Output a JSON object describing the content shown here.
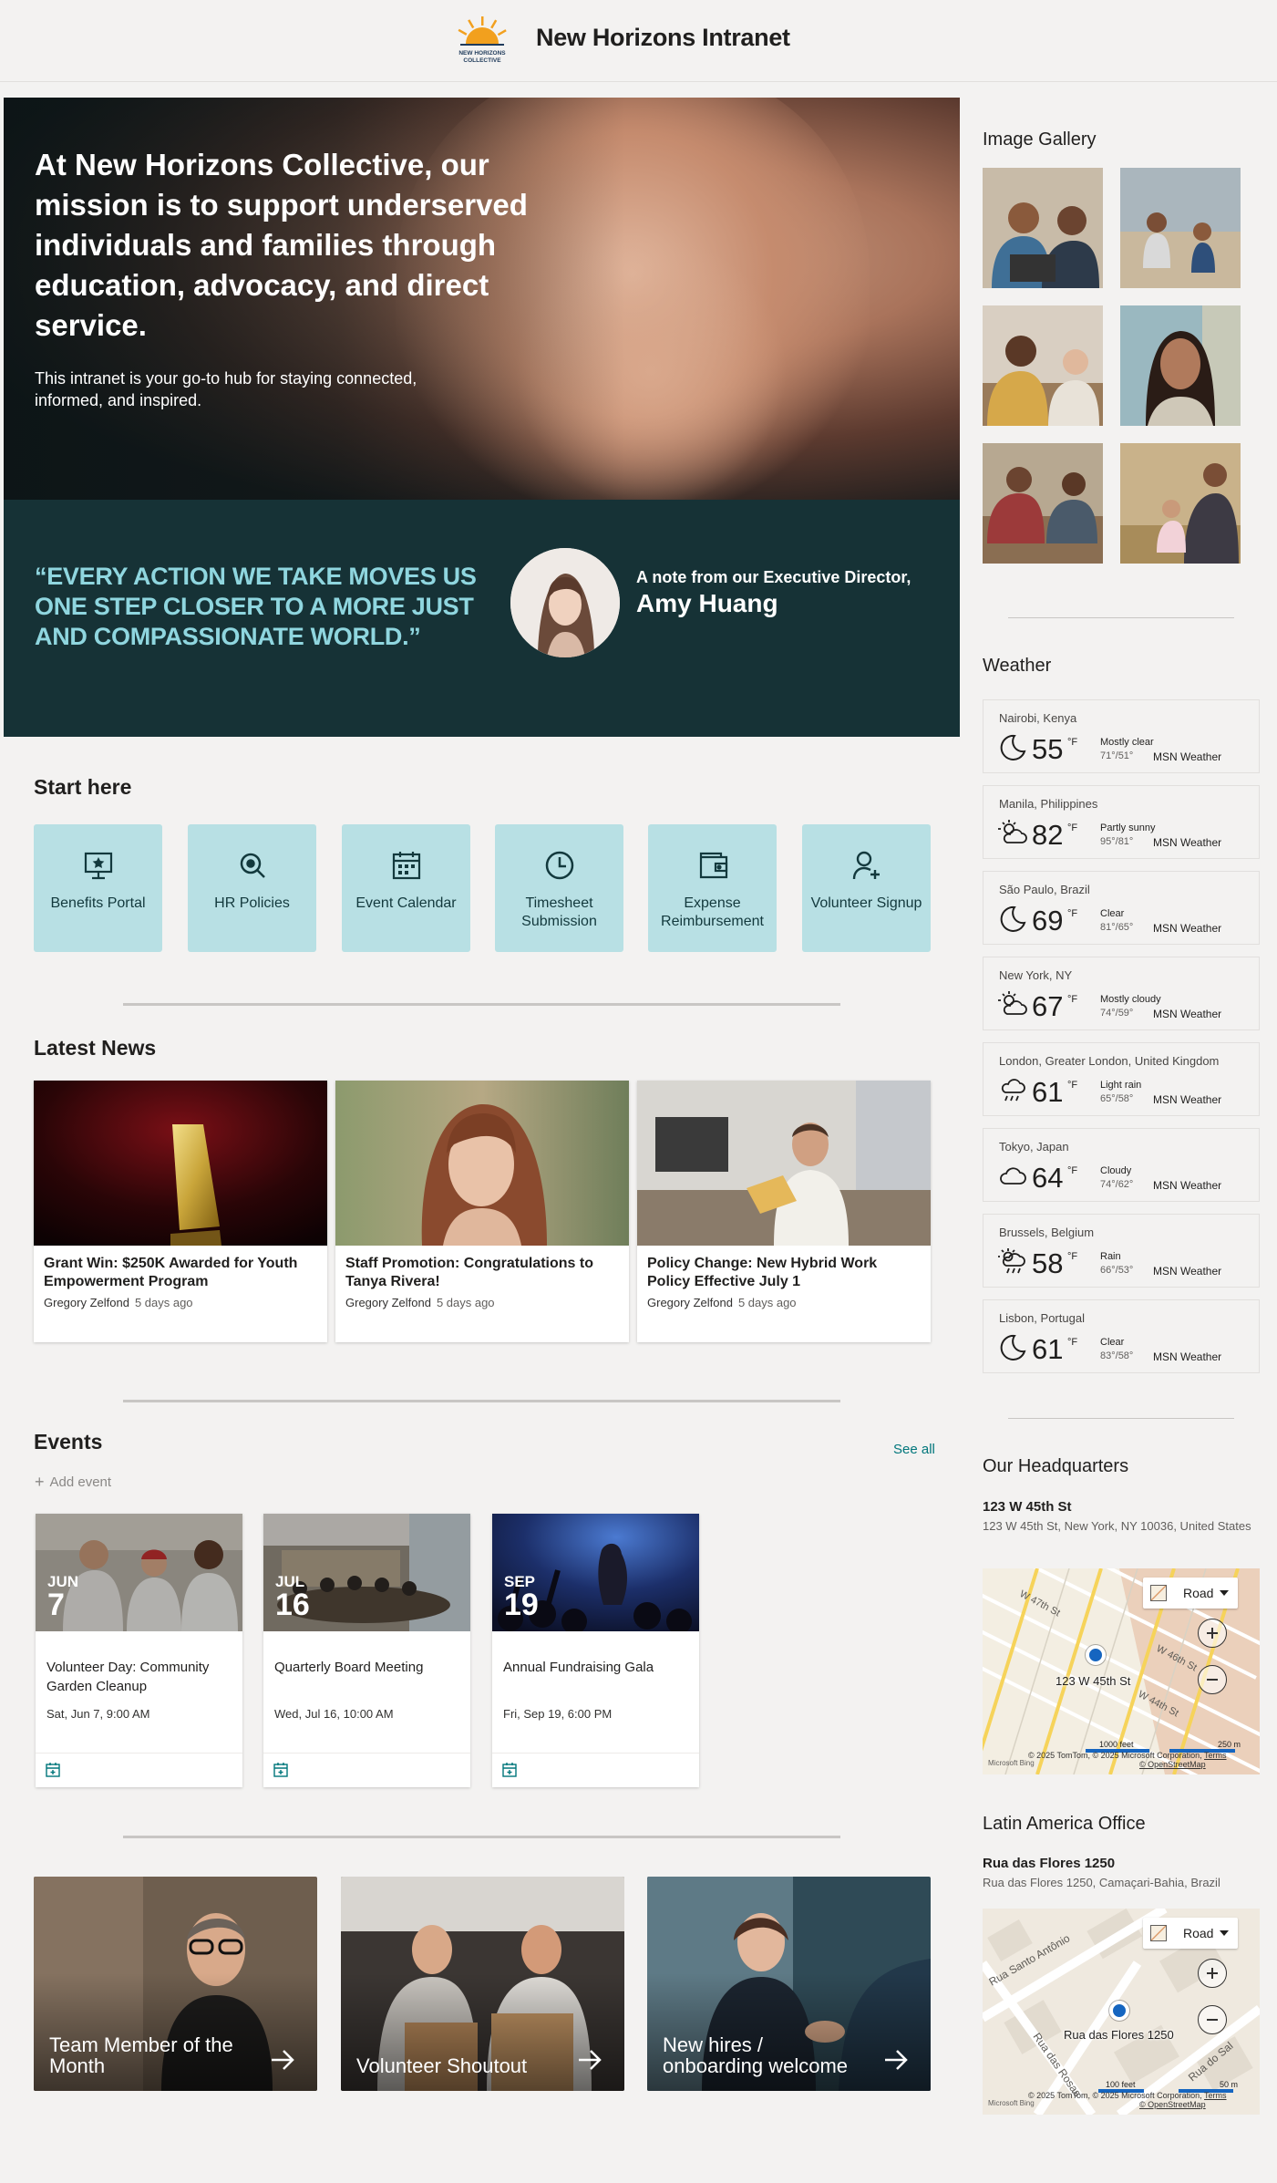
{
  "site": {
    "title": "New Horizons Intranet",
    "logo_text_line1": "NEW HORIZONS",
    "logo_text_line2": "COLLECTIVE"
  },
  "hero": {
    "title": "At New Horizons Collective, our mission is to support underserved individuals and families through education, advocacy, and direct service.",
    "subtitle": "This intranet is your go-to hub for staying connected, informed, and inspired."
  },
  "quote": {
    "text": "“EVERY ACTION WE TAKE MOVES US ONE STEP CLOSER TO A MORE JUST AND COMPASSIONATE WORLD.”",
    "note": "A note from our Executive Director,",
    "name": "Amy Huang"
  },
  "start_here": {
    "title": "Start here",
    "links": [
      {
        "label": "Benefits Portal",
        "icon": "presentation-star-icon"
      },
      {
        "label": "HR Policies",
        "icon": "search-policy-icon"
      },
      {
        "label": "Event Calendar",
        "icon": "calendar-icon"
      },
      {
        "label": "Timesheet Submission",
        "icon": "clock-icon"
      },
      {
        "label": "Expense Reimbursement",
        "icon": "wallet-icon"
      },
      {
        "label": "Volunteer Signup",
        "icon": "person-add-icon"
      }
    ]
  },
  "news": {
    "title": "Latest News",
    "items": [
      {
        "title": "Grant Win: $250K Awarded for Youth Empowerment Program",
        "author": "Gregory Zelfond",
        "ago": "5 days ago"
      },
      {
        "title": "Staff Promotion: Congratulations to Tanya Rivera!",
        "author": "Gregory Zelfond",
        "ago": "5 days ago"
      },
      {
        "title": "Policy Change: New Hybrid Work Policy Effective July 1",
        "author": "Gregory Zelfond",
        "ago": "5 days ago"
      }
    ]
  },
  "events": {
    "title": "Events",
    "see_all": "See all",
    "add_event": "Add event",
    "items": [
      {
        "month": "JUN",
        "day": "7",
        "title": "Volunteer Day: Community Garden Cleanup",
        "date": "Sat, Jun 7, 9:00 AM"
      },
      {
        "month": "JUL",
        "day": "16",
        "title": "Quarterly Board Meeting",
        "date": "Wed, Jul 16, 10:00 AM"
      },
      {
        "month": "SEP",
        "day": "19",
        "title": "Annual Fundraising Gala",
        "date": "Fri, Sep 19, 6:00 PM"
      }
    ]
  },
  "tiles": [
    {
      "label": "Team Member of the Month"
    },
    {
      "label": "Volunteer Shoutout"
    },
    {
      "label": "New hires / onboarding welcome"
    }
  ],
  "gallery": {
    "title": "Image Gallery"
  },
  "weather": {
    "title": "Weather",
    "unit": "°F",
    "source": "MSN Weather",
    "items": [
      {
        "city": "Nairobi, Kenya",
        "temp": "55",
        "cond": "Mostly clear",
        "range": "71°/51°",
        "icon": "moon-icon"
      },
      {
        "city": "Manila, Philippines",
        "temp": "82",
        "cond": "Partly sunny",
        "range": "95°/81°",
        "icon": "partly-sunny-icon"
      },
      {
        "city": "São Paulo, Brazil",
        "temp": "69",
        "cond": "Clear",
        "range": "81°/65°",
        "icon": "moon-icon"
      },
      {
        "city": "New York, NY",
        "temp": "67",
        "cond": "Mostly cloudy",
        "range": "74°/59°",
        "icon": "partly-sunny-icon"
      },
      {
        "city": "London, Greater London, United Kingdom",
        "temp": "61",
        "cond": "Light rain",
        "range": "65°/58°",
        "icon": "rain-icon"
      },
      {
        "city": "Tokyo, Japan",
        "temp": "64",
        "cond": "Cloudy",
        "range": "74°/62°",
        "icon": "cloud-icon"
      },
      {
        "city": "Brussels, Belgium",
        "temp": "58",
        "cond": "Rain",
        "range": "66°/53°",
        "icon": "sun-rain-icon"
      },
      {
        "city": "Lisbon, Portugal",
        "temp": "61",
        "cond": "Clear",
        "range": "83°/58°",
        "icon": "moon-icon"
      }
    ]
  },
  "hq": {
    "title": "Our Headquarters",
    "name": "123 W 45th St",
    "address": "123 W 45th St, New York, NY 10036, United States",
    "map": {
      "style": "Road",
      "pin_label": "123 W 45th St",
      "scale_ft": "1000 feet",
      "scale_m": "250 m",
      "copyright": "© 2025 TomTom, © 2025 Microsoft Corporation,",
      "terms": "Terms",
      "osm": "© OpenStreetMap",
      "brand": "Microsoft Bing"
    }
  },
  "latam": {
    "title": "Latin America Office",
    "name": "Rua das Flores 1250",
    "address": "Rua das Flores 1250, Camaçari-Bahia, Brazil",
    "map": {
      "style": "Road",
      "pin_label": "Rua das Flores 1250",
      "scale_ft": "100 feet",
      "scale_m": "50 m",
      "copyright": "© 2025 TomTom, © 2025 Microsoft Corporation,",
      "terms": "Terms",
      "osm": "© OpenStreetMap",
      "brand": "Microsoft Bing"
    }
  }
}
